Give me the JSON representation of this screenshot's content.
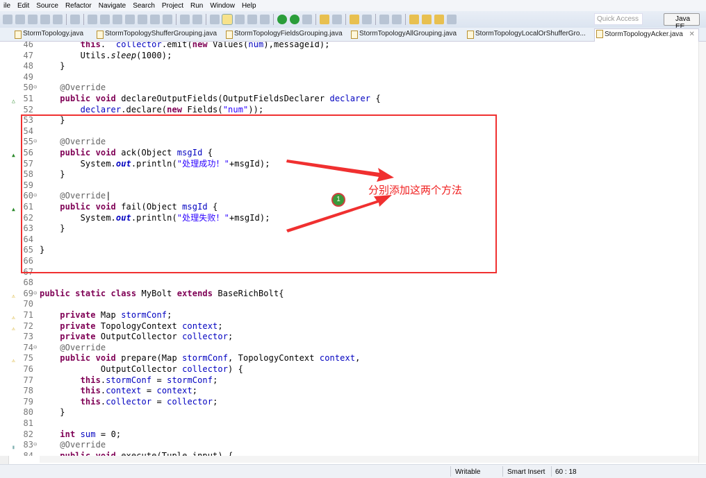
{
  "menu": [
    "ile",
    "Edit",
    "Source",
    "Refactor",
    "Navigate",
    "Search",
    "Project",
    "Run",
    "Window",
    "Help"
  ],
  "toolbar": {
    "quick_access_placeholder": "Quick Access",
    "perspective": "Java EE"
  },
  "tabs": [
    "StormTopology.java",
    "StormTopologyShufferGrouping.java",
    "StormTopologyFieldsGrouping.java",
    "StormTopologyAllGrouping.java",
    "StormTopologyLocalOrShufferGro...",
    "StormTopologyAcker.java"
  ],
  "active_tab": 5,
  "code": [
    {
      "n": "46",
      "s": [
        [
          "",
          "        "
        ],
        [
          "kw",
          "this"
        ],
        [
          "",
          ".  "
        ],
        [
          "fld",
          "collector"
        ],
        [
          "",
          ".emit("
        ],
        [
          "kw",
          "new"
        ],
        [
          "",
          " Values("
        ],
        [
          "fld",
          "num"
        ],
        [
          "",
          "),messageId);"
        ]
      ]
    },
    {
      "n": "47",
      "s": [
        [
          "",
          "        Utils."
        ],
        [
          "it",
          "sleep"
        ],
        [
          "",
          "(1000);"
        ]
      ]
    },
    {
      "n": "48",
      "s": [
        [
          "",
          "    }"
        ]
      ]
    },
    {
      "n": "49",
      "s": []
    },
    {
      "n": "50",
      "f": "⊖",
      "s": [
        [
          "ann",
          "    @Override"
        ]
      ]
    },
    {
      "n": "51",
      "g": "△",
      "s": [
        [
          "kw",
          "    public void"
        ],
        [
          "",
          " declareOutputFields(OutputFieldsDeclarer "
        ],
        [
          "fld",
          "declarer"
        ],
        [
          "",
          " {"
        ]
      ]
    },
    {
      "n": "52",
      "s": [
        [
          "fld",
          "        declarer"
        ],
        [
          "",
          ".declare("
        ],
        [
          "kw",
          "new"
        ],
        [
          "",
          " Fields("
        ],
        [
          "str",
          "\"num\""
        ],
        [
          "",
          "));"
        ]
      ]
    },
    {
      "n": "53",
      "s": [
        [
          "",
          "    }"
        ]
      ]
    },
    {
      "n": "54",
      "s": []
    },
    {
      "n": "55",
      "f": "⊖",
      "s": [
        [
          "ann",
          "    @Override"
        ]
      ]
    },
    {
      "n": "56",
      "g": "▲",
      "s": [
        [
          "kw",
          "    public void"
        ],
        [
          "",
          " ack(Object "
        ],
        [
          "fld",
          "msgId"
        ],
        [
          "",
          " {"
        ]
      ]
    },
    {
      "n": "57",
      "s": [
        [
          "",
          "        System."
        ],
        [
          "st",
          "out"
        ],
        [
          "",
          ".println("
        ],
        [
          "str",
          "\"处理成功！\""
        ],
        [
          "",
          "+msgId);"
        ]
      ]
    },
    {
      "n": "58",
      "s": [
        [
          "",
          "    }"
        ]
      ]
    },
    {
      "n": "59",
      "s": []
    },
    {
      "n": "60",
      "f": "⊖",
      "s": [
        [
          "ann",
          "    @Override"
        ],
        [
          "",
          "|"
        ]
      ]
    },
    {
      "n": "61",
      "g": "▲",
      "s": [
        [
          "kw",
          "    public void"
        ],
        [
          "",
          " fail(Object "
        ],
        [
          "fld",
          "msgId"
        ],
        [
          "",
          " {"
        ]
      ]
    },
    {
      "n": "62",
      "s": [
        [
          "",
          "        System."
        ],
        [
          "st",
          "out"
        ],
        [
          "",
          ".println("
        ],
        [
          "str",
          "\"处理失败！\""
        ],
        [
          "",
          "+msgId);"
        ]
      ]
    },
    {
      "n": "63",
      "s": [
        [
          "",
          "    }"
        ]
      ]
    },
    {
      "n": "64",
      "s": []
    },
    {
      "n": "65",
      "s": [
        [
          "",
          "}"
        ]
      ]
    },
    {
      "n": "66",
      "s": []
    },
    {
      "n": "67",
      "s": []
    },
    {
      "n": "68",
      "s": []
    },
    {
      "n": "69",
      "f": "⊖",
      "g": "⚠",
      "s": [
        [
          "kw",
          "public static class"
        ],
        [
          "",
          " MyBolt "
        ],
        [
          "kw",
          "extends"
        ],
        [
          "",
          " BaseRichBolt{"
        ]
      ]
    },
    {
      "n": "70",
      "s": []
    },
    {
      "n": "71",
      "g": "⚠",
      "s": [
        [
          "kw",
          "    private"
        ],
        [
          "",
          " Map "
        ],
        [
          "fld",
          "stormConf"
        ],
        [
          "",
          ";"
        ]
      ]
    },
    {
      "n": "72",
      "g": "⚠",
      "s": [
        [
          "kw",
          "    private"
        ],
        [
          "",
          " TopologyContext "
        ],
        [
          "fld",
          "context"
        ],
        [
          "",
          ";"
        ]
      ]
    },
    {
      "n": "73",
      "s": [
        [
          "kw",
          "    private"
        ],
        [
          "",
          " OutputCollector "
        ],
        [
          "fld",
          "collector"
        ],
        [
          "",
          ";"
        ]
      ]
    },
    {
      "n": "74",
      "f": "⊖",
      "s": [
        [
          "ann",
          "    @Override"
        ]
      ]
    },
    {
      "n": "75",
      "g": "⚠",
      "s": [
        [
          "kw",
          "    public void"
        ],
        [
          "",
          " prepare(Map "
        ],
        [
          "fld",
          "stormConf"
        ],
        [
          "",
          ", TopologyContext "
        ],
        [
          "fld",
          "context"
        ],
        [
          "",
          ","
        ]
      ]
    },
    {
      "n": "76",
      "s": [
        [
          "",
          "            OutputCollector "
        ],
        [
          "fld",
          "collector"
        ],
        [
          "",
          ") {"
        ]
      ]
    },
    {
      "n": "77",
      "s": [
        [
          "kw",
          "        this"
        ],
        [
          "",
          "."
        ],
        [
          "fld",
          "stormConf"
        ],
        [
          "",
          " = "
        ],
        [
          "fld",
          "stormConf"
        ],
        [
          "",
          ";"
        ]
      ]
    },
    {
      "n": "78",
      "s": [
        [
          "kw",
          "        this"
        ],
        [
          "",
          "."
        ],
        [
          "fld",
          "context"
        ],
        [
          "",
          " = "
        ],
        [
          "fld",
          "context"
        ],
        [
          "",
          ";"
        ]
      ]
    },
    {
      "n": "79",
      "s": [
        [
          "kw",
          "        this"
        ],
        [
          "",
          "."
        ],
        [
          "fld",
          "collector"
        ],
        [
          "",
          " = "
        ],
        [
          "fld",
          "collector"
        ],
        [
          "",
          ";"
        ]
      ]
    },
    {
      "n": "80",
      "s": [
        [
          "",
          "    }"
        ]
      ]
    },
    {
      "n": "81",
      "s": []
    },
    {
      "n": "82",
      "s": [
        [
          "kw",
          "    int"
        ],
        [
          "",
          " "
        ],
        [
          "fld",
          "sum"
        ],
        [
          "",
          " = 0;"
        ]
      ]
    },
    {
      "n": "83",
      "f": "⊖",
      "g": "▮",
      "s": [
        [
          "ann",
          "    @Override"
        ]
      ]
    },
    {
      "n": "84",
      "s": [
        [
          "kw",
          "    public void"
        ],
        [
          "",
          " execute(Tuple input) {"
        ]
      ]
    }
  ],
  "annotation": {
    "text": "分别添加这两个方法",
    "badge": "1",
    "color": "#f03030"
  },
  "status": {
    "mode": "Writable",
    "insert": "Smart Insert",
    "position": "60 : 18"
  }
}
